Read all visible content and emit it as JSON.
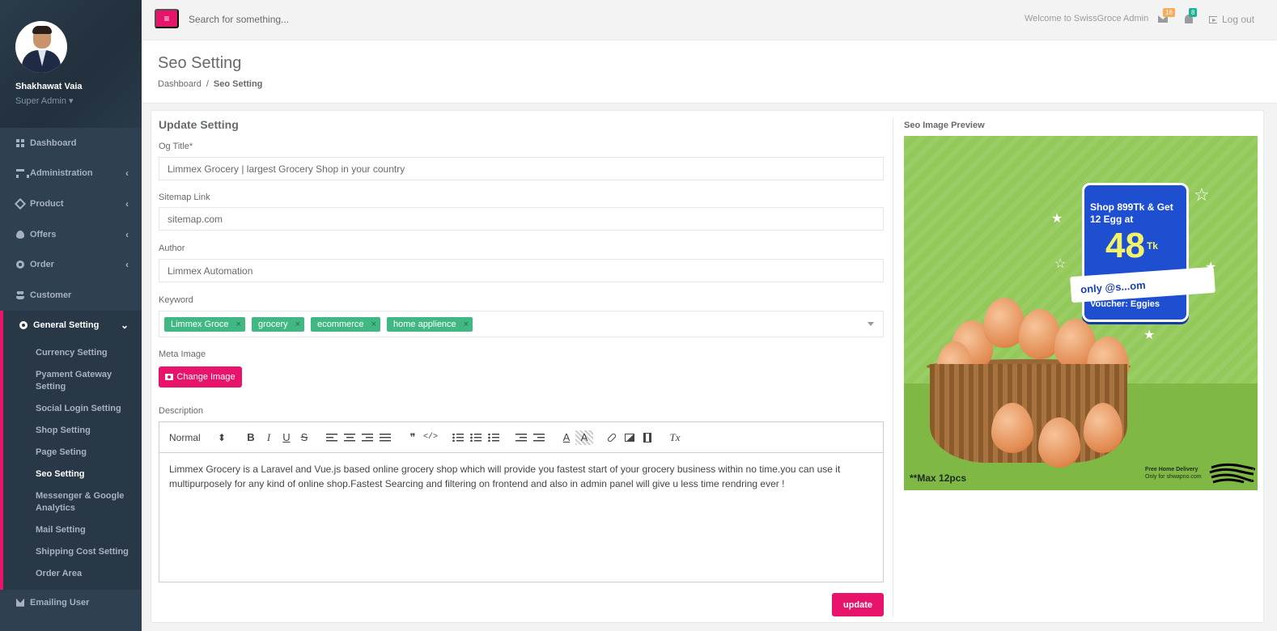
{
  "user": {
    "name": "Shakhawat Vaia",
    "role": "Super Admin ▾"
  },
  "sidebar": {
    "items": [
      {
        "label": "Dashboard",
        "icon": "dashboard-icon",
        "has_children": false
      },
      {
        "label": "Administration",
        "icon": "sitemap-icon",
        "has_children": true
      },
      {
        "label": "Product",
        "icon": "diamond-icon",
        "has_children": true
      },
      {
        "label": "Offers",
        "icon": "fire-icon",
        "has_children": true
      },
      {
        "label": "Order",
        "icon": "cog-icon",
        "has_children": true
      },
      {
        "label": "Customer",
        "icon": "users-icon",
        "has_children": false
      },
      {
        "label": "General Setting",
        "icon": "gear-icon",
        "has_children": true,
        "expanded": true
      }
    ],
    "general_setting_children": [
      "Currency Setting",
      "Pyament Gateway Setting",
      "Social Login Setting",
      "Shop Setting",
      "Page Seting",
      "Seo Setting",
      "Messenger & Google Analytics",
      "Mail Setting",
      "Shipping Cost Setting",
      "Order Area"
    ],
    "current_child": "Seo Setting",
    "bottom_item": {
      "label": "Emailing User",
      "icon": "envelope-icon"
    }
  },
  "topbar": {
    "menu_glyph": "≡",
    "search_placeholder": "Search for something...",
    "welcome": "Welcome to SwissGroce Admin",
    "mail_count": "16",
    "notification_count": "8",
    "logout": "Log out"
  },
  "page": {
    "title": "Seo Setting",
    "breadcrumb": [
      "Dashboard",
      "/",
      "Seo Setting"
    ]
  },
  "form": {
    "section_title": "Update Setting",
    "og_title_label": "Og Title*",
    "og_title_value": "Limmex Grocery | largest Grocery Shop in your country",
    "sitemap_label": "Sitemap Link",
    "sitemap_value": "sitemap.com",
    "author_label": "Author",
    "author_value": "Limmex Automation",
    "keyword_label": "Keyword",
    "keywords": [
      "Limmex Groce",
      "grocery",
      "ecommerce",
      "home applience"
    ],
    "tag_remove_glyph": "×",
    "meta_image_label": "Meta Image",
    "change_image_label": "Change Image",
    "description_label": "Description",
    "editor": {
      "format_value": "Normal",
      "format_arrows": "⬍",
      "bold": "B",
      "italic": "I",
      "underline": "U",
      "strike": "S",
      "quote": "❞",
      "code": "</>",
      "clean": "Tx",
      "text_color": "A",
      "text_bg": "A"
    },
    "description_value": "Limmex Grocery is a Laravel and Vue.js based online grocery shop which will provide you fastest start of your grocery business within no time.you can use it multipurposely for any kind of online shop.Fastest Searcing and filtering on frontend and also in admin panel will give u less time rendring ever !",
    "update_label": "update"
  },
  "preview": {
    "title": "Seo Image Preview",
    "promo_heading": "Shop 899Tk & Get 12 Egg at",
    "promo_price": "48",
    "promo_currency": "Tk",
    "promo_ribbon": "only @s...om",
    "promo_voucher": "Voucher: Eggies",
    "max_note": "**Max 12pcs",
    "delivery_line1": "Free Home Delivery",
    "delivery_line2": "Only for shwapno.com"
  },
  "colors": {
    "sidebar_bg": "#2f4050",
    "accent": "#e8146c",
    "tag": "#41b883",
    "preview_bg": "#93c95a",
    "badge_orange": "#f8ac59",
    "badge_green": "#1ab394"
  }
}
